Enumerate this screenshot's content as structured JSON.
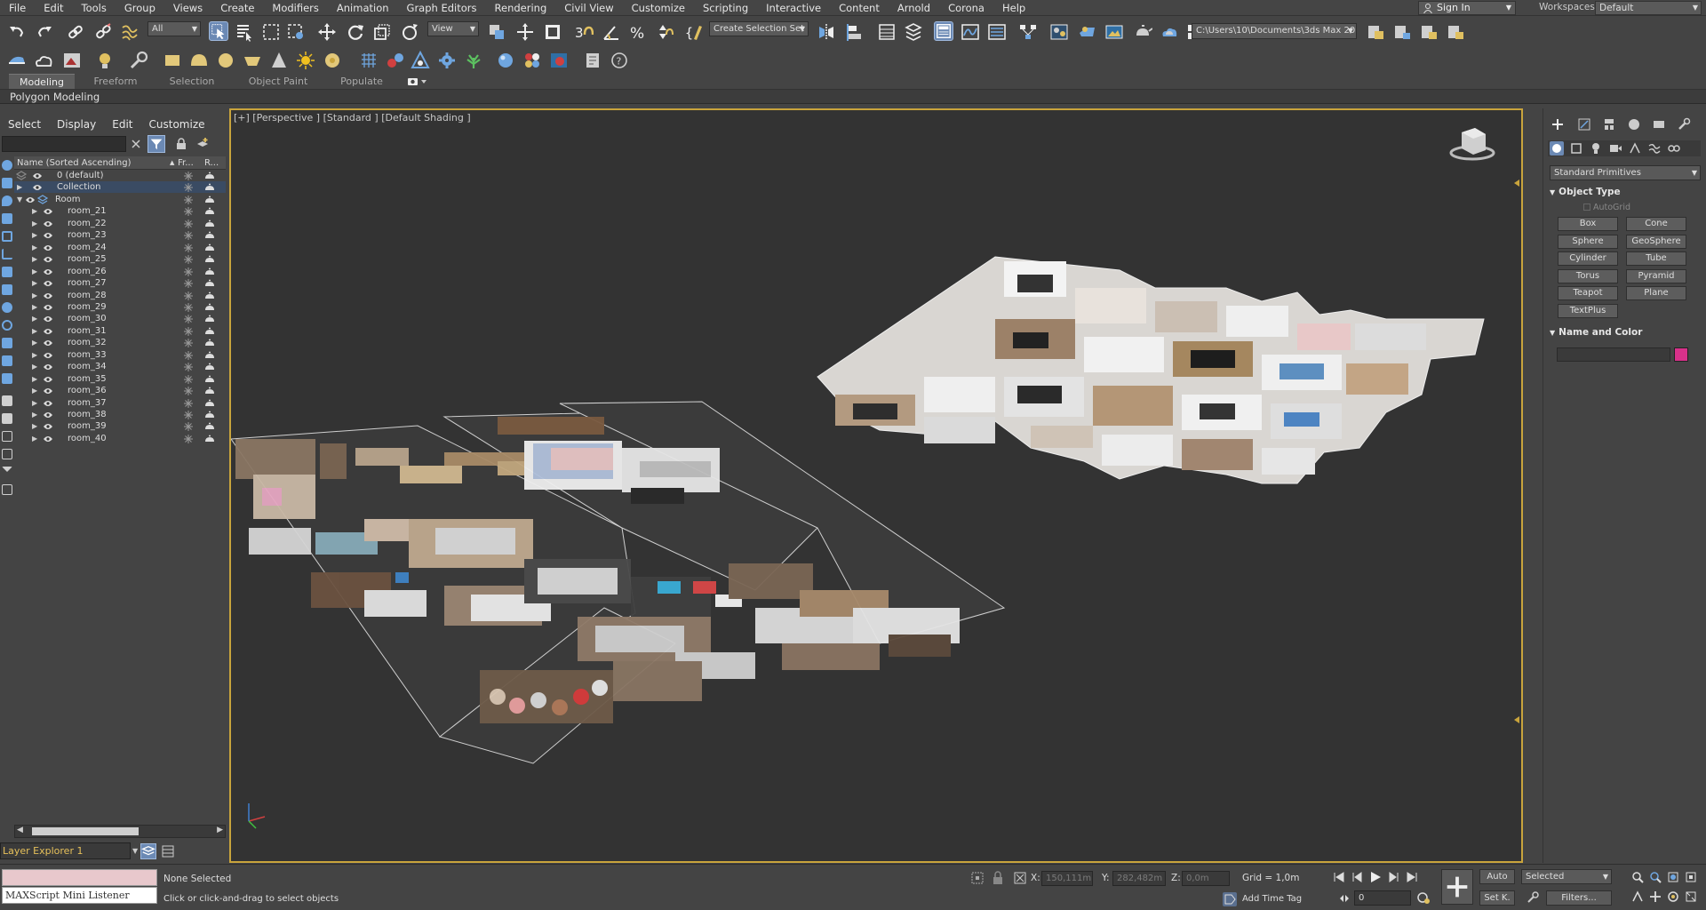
{
  "menu": [
    "File",
    "Edit",
    "Tools",
    "Group",
    "Views",
    "Create",
    "Modifiers",
    "Animation",
    "Graph Editors",
    "Rendering",
    "Civil View",
    "Customize",
    "Scripting",
    "Interactive",
    "Content",
    "Arnold",
    "Corona",
    "Help"
  ],
  "account": {
    "sign_in": "Sign In",
    "workspaces_label": "Workspaces:",
    "workspace": "Default"
  },
  "toolbar": {
    "selection_filter": "All",
    "reference_coord": "View",
    "named_selection": "Create Selection Set",
    "project_path": "C:\\Users\\10\\Documents\\3ds Max 2020"
  },
  "ribbon": {
    "tabs": [
      "Modeling",
      "Freeform",
      "Selection",
      "Object Paint",
      "Populate"
    ],
    "active_tab": "Modeling",
    "panel_title": "Polygon Modeling"
  },
  "scene_explorer": {
    "menu": [
      "Select",
      "Display",
      "Edit",
      "Customize"
    ],
    "columns": {
      "name": "Name (Sorted Ascending)",
      "frozen": "Fr...",
      "render": "R..."
    },
    "rows": [
      {
        "label": "0 (default)"
      },
      {
        "label": "Collection"
      },
      {
        "label": "Room"
      },
      {
        "label": "room_21"
      },
      {
        "label": "room_22"
      },
      {
        "label": "room_23"
      },
      {
        "label": "room_24"
      },
      {
        "label": "room_25"
      },
      {
        "label": "room_26"
      },
      {
        "label": "room_27"
      },
      {
        "label": "room_28"
      },
      {
        "label": "room_29"
      },
      {
        "label": "room_30"
      },
      {
        "label": "room_31"
      },
      {
        "label": "room_32"
      },
      {
        "label": "room_33"
      },
      {
        "label": "room_34"
      },
      {
        "label": "room_35"
      },
      {
        "label": "room_36"
      },
      {
        "label": "room_37"
      },
      {
        "label": "room_38"
      },
      {
        "label": "room_39"
      },
      {
        "label": "room_40"
      }
    ],
    "layer_explorer": "Layer Explorer 1"
  },
  "viewport": {
    "label": "[+] [Perspective ] [Standard ] [Default Shading ]"
  },
  "command_panel": {
    "category": "Standard Primitives",
    "object_type_title": "Object Type",
    "autogrid": "AutoGrid",
    "buttons": [
      "Box",
      "Cone",
      "Sphere",
      "GeoSphere",
      "Cylinder",
      "Tube",
      "Torus",
      "Pyramid",
      "Teapot",
      "Plane",
      "TextPlus"
    ],
    "name_color_title": "Name and Color",
    "object_color": "#d8318a"
  },
  "status": {
    "maxscript": "MAXScript Mini Listener",
    "selection": "None Selected",
    "prompt": "Click or click-and-drag to select objects",
    "x_label": "X:",
    "x_value": "150,111m",
    "y_label": "Y:",
    "y_value": "282,482m",
    "z_label": "Z:",
    "z_value": "0,0m",
    "grid": "Grid = 1,0m",
    "add_time_tag": "Add Time Tag",
    "auto_key": "Auto",
    "set_key": "Set K.",
    "key_mode": "Selected",
    "filters": "Filters...",
    "frame": "0"
  },
  "colors": {
    "accent": "#c9a43c",
    "selected": "#6b89b4",
    "viewport_bg": "#333333"
  }
}
